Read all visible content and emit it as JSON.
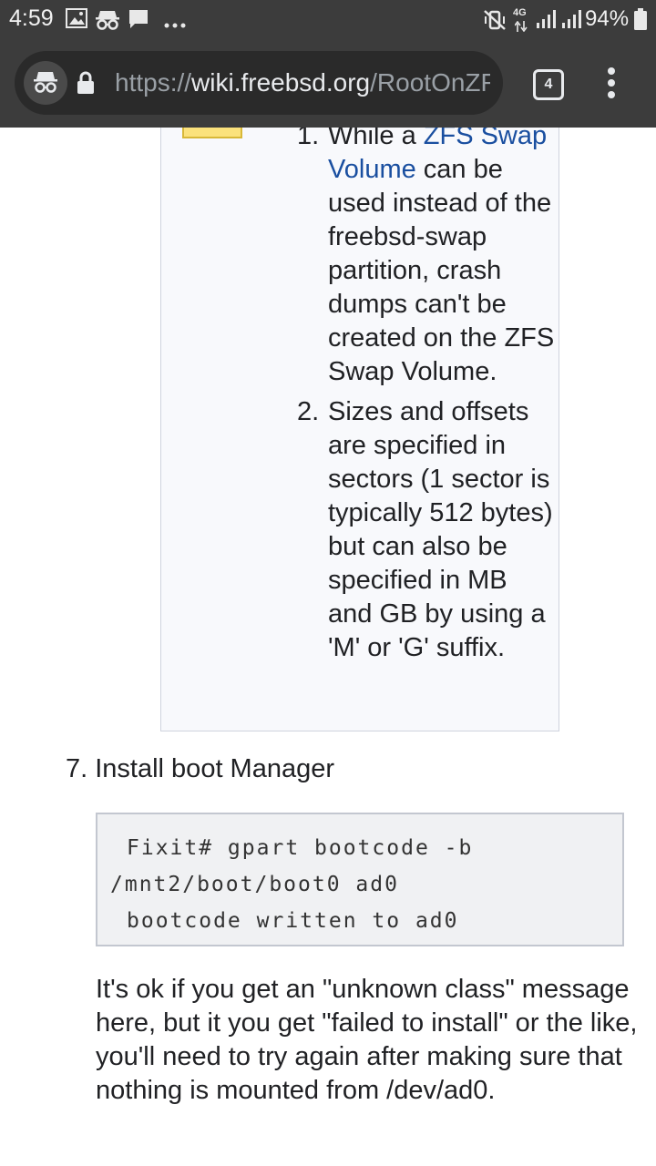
{
  "status_bar": {
    "time": "4:59",
    "left_icons": [
      "image-icon",
      "incognito-icon",
      "chat-icon",
      "more-notifications-icon"
    ],
    "network_label": "4G",
    "battery_percent": "94%"
  },
  "toolbar": {
    "url_scheme": "https://",
    "url_host": "wiki.freebsd.org",
    "url_path": "/RootOnZFS",
    "tab_count": "4"
  },
  "note": {
    "items": [
      {
        "number": "1.",
        "prefix": "While a ",
        "link": "ZFS Swap Volume",
        "suffix": " can be used instead of the freebsd-swap partition, crash dumps can't be created on the ZFS Swap Volume."
      },
      {
        "number": "2.",
        "text": "Sizes and offsets are specified in sectors (1 sector is typically 512 bytes) but can also be specified in MB and GB by using a 'M' or 'G' suffix."
      }
    ]
  },
  "content": {
    "step_heading": "7. Install boot Manager",
    "code": {
      "line1": "Fixit# gpart bootcode -b",
      "line2": "/mnt2/boot/boot0 ad0",
      "line3": "bootcode written to ad0"
    },
    "paragraph": "It's ok if you get an \"unknown class\" message here, but it you get \"failed to install\" or the like, you'll need to try again after making sure that nothing is mounted from /dev/ad0."
  },
  "colors": {
    "chrome_bar": "#3c3c3c",
    "omnibox": "#2a2a2a",
    "link": "#1a4fa0",
    "note_bg": "#f8f9fc",
    "code_bg": "#f0f1f3"
  }
}
